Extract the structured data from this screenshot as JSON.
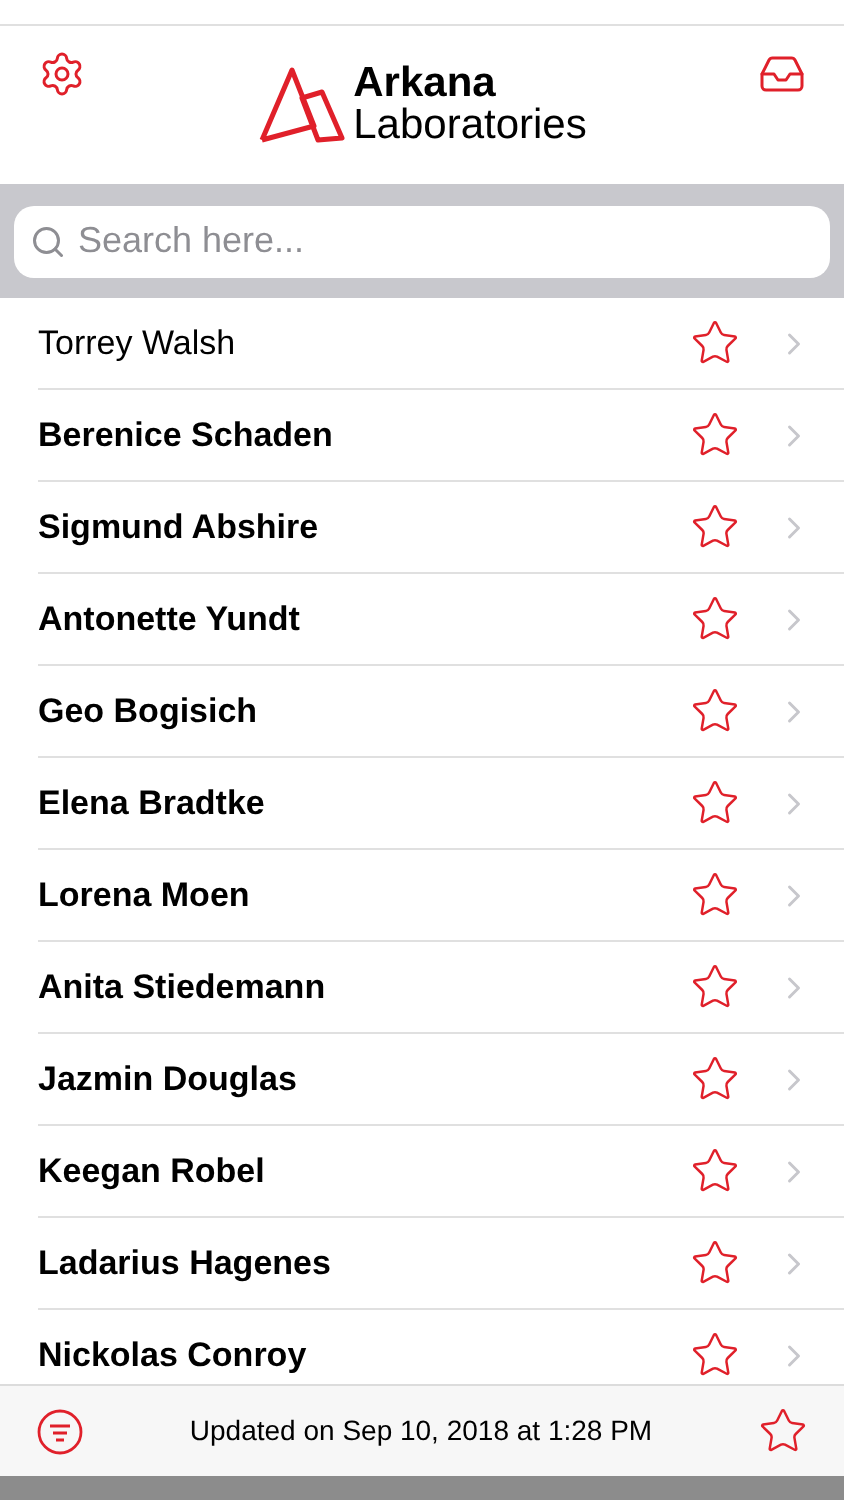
{
  "header": {
    "brand_top": "Arkana",
    "brand_bottom": "Laboratories"
  },
  "search": {
    "placeholder": "Search here..."
  },
  "contacts": [
    {
      "name": "Torrey Walsh",
      "unread": false,
      "starred": false
    },
    {
      "name": "Berenice Schaden",
      "unread": true,
      "starred": false
    },
    {
      "name": "Sigmund Abshire",
      "unread": true,
      "starred": false
    },
    {
      "name": "Antonette Yundt",
      "unread": true,
      "starred": false
    },
    {
      "name": "Geo Bogisich",
      "unread": true,
      "starred": false
    },
    {
      "name": "Elena Bradtke",
      "unread": true,
      "starred": false
    },
    {
      "name": "Lorena Moen",
      "unread": true,
      "starred": false
    },
    {
      "name": "Anita Stiedemann",
      "unread": true,
      "starred": false
    },
    {
      "name": "Jazmin Douglas",
      "unread": true,
      "starred": false
    },
    {
      "name": "Keegan Robel",
      "unread": true,
      "starred": false
    },
    {
      "name": "Ladarius Hagenes",
      "unread": true,
      "starred": false
    },
    {
      "name": "Nickolas Conroy",
      "unread": true,
      "starred": false
    }
  ],
  "footer": {
    "status": "Updated on Sep 10, 2018 at 1:28 PM"
  }
}
